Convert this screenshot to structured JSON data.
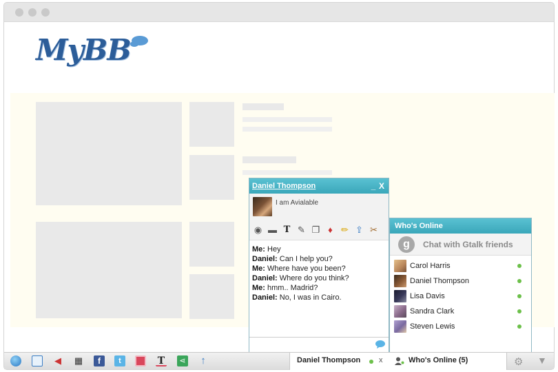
{
  "logo": {
    "text": "MyBB"
  },
  "chat_window": {
    "contact_name": "Daniel Thompson",
    "minimize_label": "_",
    "close_label": "X",
    "status_text": "I am Avialable",
    "toolbar_icons": [
      "webcam-icon",
      "screen-share-icon",
      "text-format-icon",
      "whiteboard-icon",
      "notes-icon",
      "cards-icon",
      "pencil-icon",
      "upload-icon",
      "broom-icon"
    ],
    "messages": [
      {
        "sender": "Me:",
        "text": "Hey"
      },
      {
        "sender": "Daniel:",
        "text": "Can I help you?"
      },
      {
        "sender": "Me:",
        "text": "Where have you been?"
      },
      {
        "sender": "Daniel:",
        "text": "Where do you think?"
      },
      {
        "sender": "Me:",
        "text": "hmm.. Madrid?"
      },
      {
        "sender": "Daniel:",
        "text": "No, I was in Cairo."
      }
    ]
  },
  "whos_online": {
    "title": "Who's Online",
    "gtalk_label": "Chat with Gtalk friends",
    "gtalk_logo": "g",
    "users": [
      {
        "name": "Carol Harris"
      },
      {
        "name": "Daniel Thompson"
      },
      {
        "name": "Lisa Davis"
      },
      {
        "name": "Sandra Clark"
      },
      {
        "name": "Steven Lewis"
      }
    ]
  },
  "bottom_bar": {
    "icons": [
      "globe-icon",
      "window-icon",
      "megaphone-icon",
      "space-invader-icon",
      "facebook-icon",
      "twitter-icon",
      "block-icon",
      "text-icon",
      "share-icon",
      "upload-arrow-icon"
    ],
    "chat_tab_label": "Daniel Thompson",
    "chat_tab_close": "x",
    "whos_online_tab": "Who's Online (5)"
  },
  "colors": {
    "header_teal": "#3aa7ba",
    "online_green": "#6cc04a",
    "logo_blue": "#2c5d99"
  }
}
